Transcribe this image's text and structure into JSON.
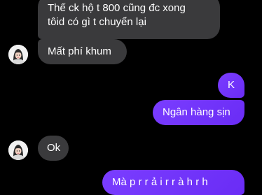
{
  "conversation": {
    "messages": [
      {
        "sender": "other",
        "text": "Thế ck hộ t 800 cũng đc xong\ntôid có gì t chuyển lại"
      },
      {
        "sender": "other",
        "text": "Mất phí khum"
      },
      {
        "sender": "self",
        "text": "K"
      },
      {
        "sender": "self",
        "text": "Ngân hàng sịn"
      },
      {
        "sender": "other",
        "text": "Ok"
      },
      {
        "sender": "self",
        "text": "Mà  p  r   r  ả i  r  r  à  h   r  h"
      }
    ]
  },
  "colors": {
    "background": "#000000",
    "incoming_bubble": "#3a3a3c",
    "outgoing_bubble": "#7a3dff",
    "text": "#ffffff"
  },
  "icons": {
    "avatar": "contact-avatar-icon"
  }
}
